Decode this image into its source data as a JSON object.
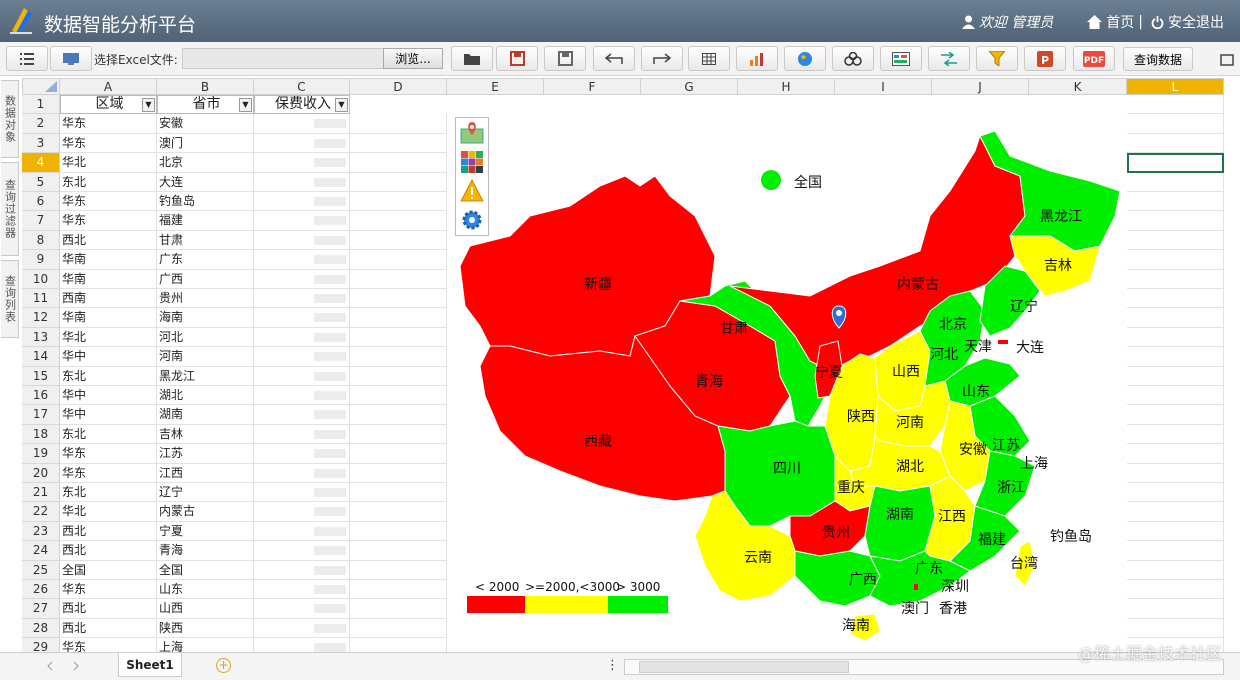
{
  "app": {
    "title": "数据智能分析平台",
    "welcome": "欢迎 管理员",
    "home": "首页",
    "logout": "安全退出"
  },
  "toolbar": {
    "file_label": "选择Excel文件:",
    "browse": "浏览...",
    "query": "查询数据",
    "pdf": "PDF"
  },
  "side_tabs": [
    "数据对象",
    "查询过滤器",
    "查询列表"
  ],
  "sheet": {
    "columns": [
      "A",
      "B",
      "C",
      "D",
      "E",
      "F",
      "G",
      "H",
      "I",
      "J",
      "K",
      "L"
    ],
    "header_row": [
      "区域",
      "省市",
      "保费收入"
    ],
    "row_numbers": [
      "1",
      "2",
      "3",
      "4",
      "5",
      "6",
      "7",
      "8",
      "9",
      "10",
      "11",
      "12",
      "13",
      "14",
      "15",
      "16",
      "17",
      "18",
      "19",
      "20",
      "21",
      "22",
      "23",
      "24",
      "25",
      "26",
      "27",
      "28",
      "29"
    ],
    "rows": [
      [
        "华东",
        "安徽"
      ],
      [
        "华东",
        "澳门"
      ],
      [
        "华北",
        "北京"
      ],
      [
        "东北",
        "大连"
      ],
      [
        "华东",
        "钓鱼岛"
      ],
      [
        "华东",
        "福建"
      ],
      [
        "西北",
        "甘肃"
      ],
      [
        "华南",
        "广东"
      ],
      [
        "华南",
        "广西"
      ],
      [
        "西南",
        "贵州"
      ],
      [
        "华南",
        "海南"
      ],
      [
        "华北",
        "河北"
      ],
      [
        "华中",
        "河南"
      ],
      [
        "东北",
        "黑龙江"
      ],
      [
        "华中",
        "湖北"
      ],
      [
        "华中",
        "湖南"
      ],
      [
        "东北",
        "吉林"
      ],
      [
        "华东",
        "江苏"
      ],
      [
        "华东",
        "江西"
      ],
      [
        "东北",
        "辽宁"
      ],
      [
        "华北",
        "内蒙古"
      ],
      [
        "西北",
        "宁夏"
      ],
      [
        "西北",
        "青海"
      ],
      [
        "全国",
        "全国"
      ],
      [
        "华东",
        "山东"
      ],
      [
        "西北",
        "山西"
      ],
      [
        "西北",
        "陕西"
      ],
      [
        "华东",
        "上海"
      ]
    ],
    "tab_name": "Sheet1"
  },
  "map": {
    "legend_national": "全国",
    "legend_labels": [
      "< 2000",
      ">=2000,<3000",
      "> 3000"
    ],
    "colors": {
      "red": "#ff0000",
      "yellow": "#ffff00",
      "green": "#00ee00"
    },
    "provinces": [
      "黑龙江",
      "吉林",
      "辽宁",
      "内蒙古",
      "新疆",
      "甘肃",
      "北京",
      "天津",
      "大连",
      "河北",
      "宁夏",
      "山西",
      "山东",
      "青海",
      "陕西",
      "河南",
      "西藏",
      "安徽",
      "江苏",
      "上海",
      "四川",
      "湖北",
      "重庆",
      "浙江",
      "湖南",
      "江西",
      "贵州",
      "福建",
      "钓鱼岛",
      "云南",
      "台湾",
      "广西",
      "广东",
      "深圳",
      "澳门",
      "香港",
      "海南"
    ]
  },
  "watermark": "@稀土掘金技术社区"
}
